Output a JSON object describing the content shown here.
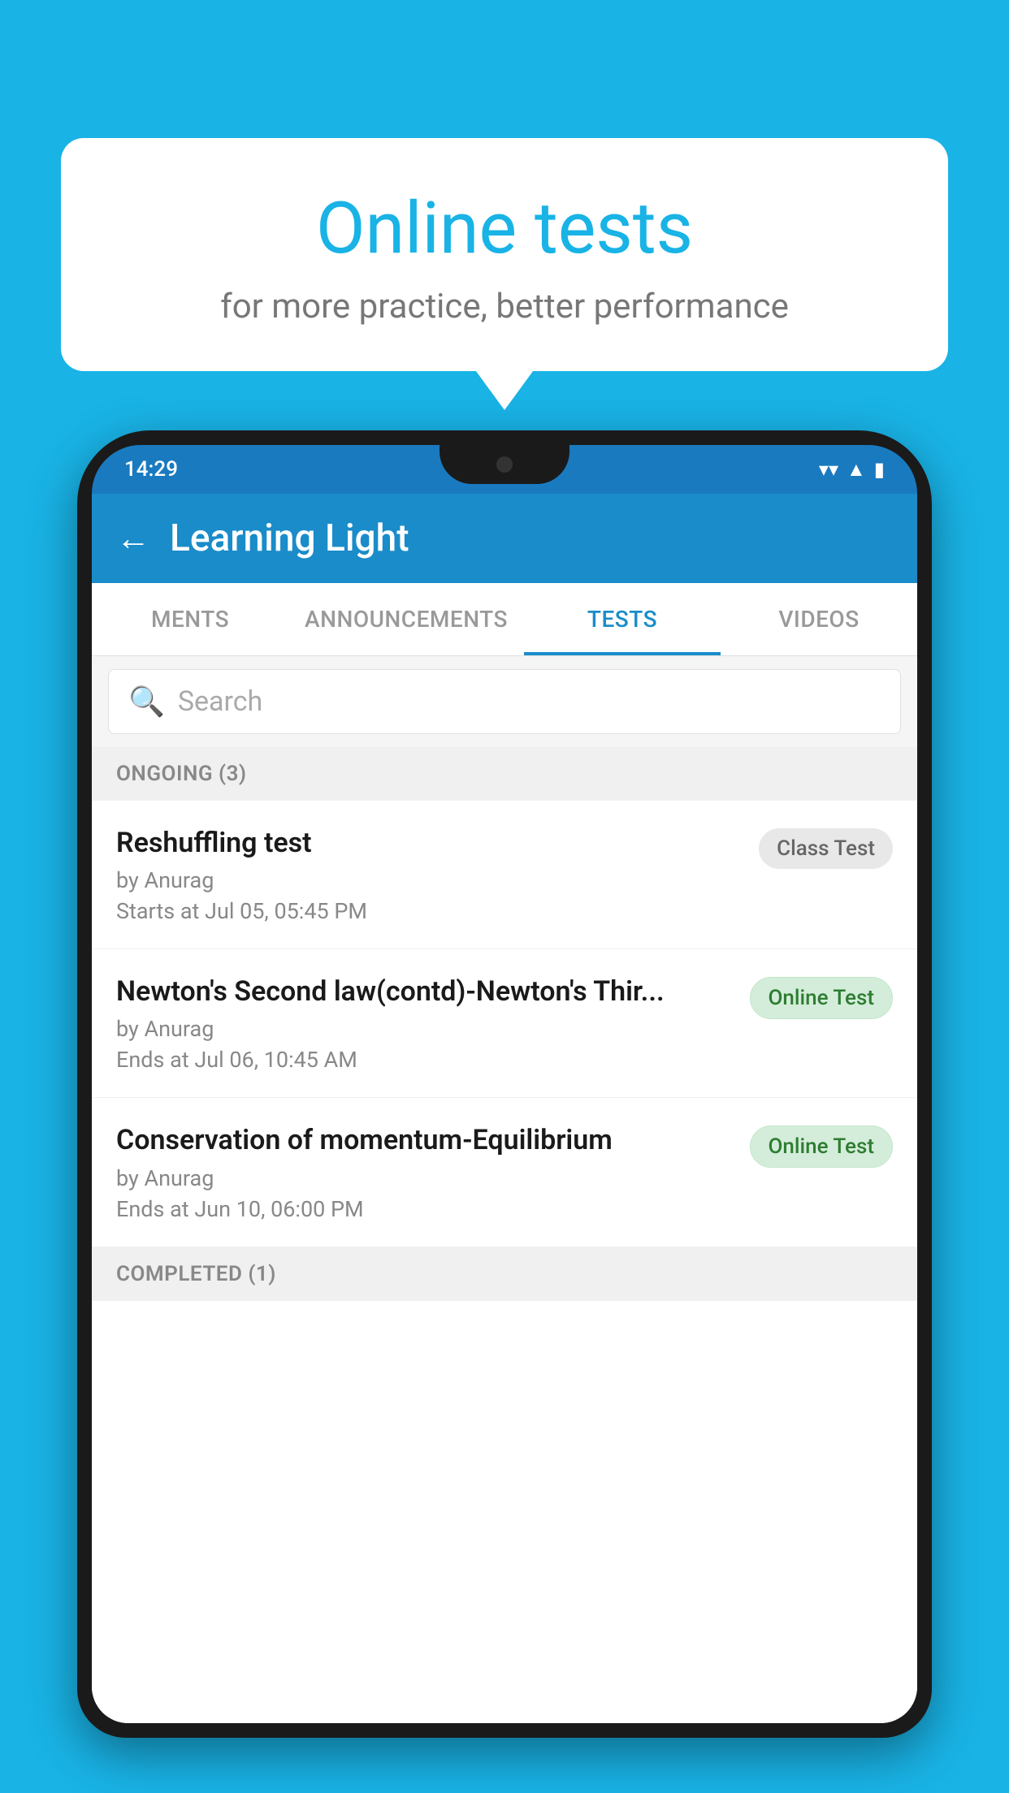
{
  "background": {
    "color": "#19b3e6"
  },
  "speech_bubble": {
    "title": "Online tests",
    "subtitle": "for more practice, better performance"
  },
  "status_bar": {
    "time": "14:29",
    "wifi": "▼",
    "signal": "◀",
    "battery": "▮"
  },
  "app_bar": {
    "back_label": "←",
    "title": "Learning Light"
  },
  "tabs": [
    {
      "label": "MENTS",
      "active": false
    },
    {
      "label": "ANNOUNCEMENTS",
      "active": false
    },
    {
      "label": "TESTS",
      "active": true
    },
    {
      "label": "VIDEOS",
      "active": false
    }
  ],
  "search": {
    "placeholder": "Search"
  },
  "ongoing_section": {
    "label": "ONGOING (3)"
  },
  "tests": [
    {
      "name": "Reshuffling test",
      "author": "by Anurag",
      "date": "Starts at  Jul 05, 05:45 PM",
      "badge": "Class Test",
      "badge_type": "class"
    },
    {
      "name": "Newton's Second law(contd)-Newton's Thir...",
      "author": "by Anurag",
      "date": "Ends at  Jul 06, 10:45 AM",
      "badge": "Online Test",
      "badge_type": "online"
    },
    {
      "name": "Conservation of momentum-Equilibrium",
      "author": "by Anurag",
      "date": "Ends at  Jun 10, 06:00 PM",
      "badge": "Online Test",
      "badge_type": "online"
    }
  ],
  "completed_section": {
    "label": "COMPLETED (1)"
  }
}
